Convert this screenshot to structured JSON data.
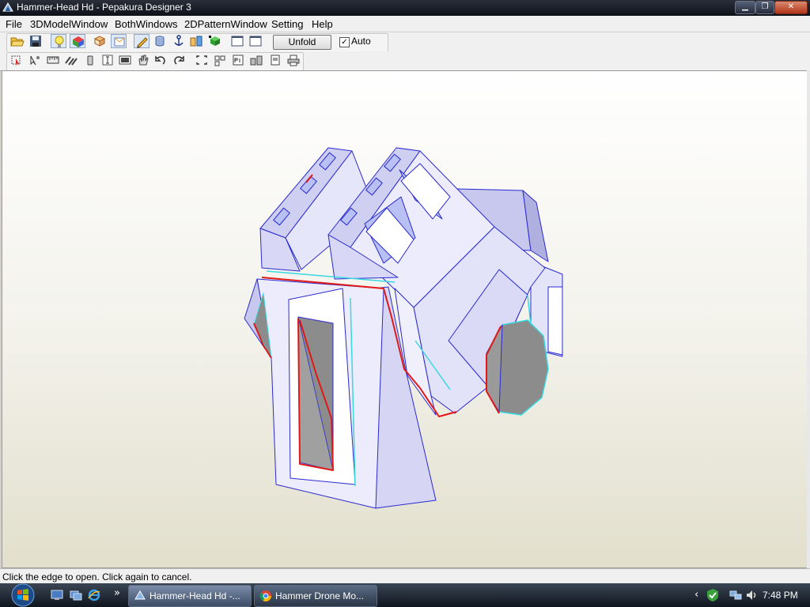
{
  "window": {
    "title": "Hammer-Head Hd - Pepakura Designer 3",
    "minimize_label": "▁",
    "restore_label": "❐",
    "close_label": "✕"
  },
  "menu": {
    "file": "File",
    "model3d": "3DModelWindow",
    "both": "BothWindows",
    "pattern2d": "2DPatternWindow",
    "setting": "Setting",
    "help": "Help"
  },
  "toolbar": {
    "unfold_label": "Unfold",
    "auto_checked": "✓",
    "auto_label": "Auto"
  },
  "status": {
    "text": "Click the edge to open. Click again to cancel."
  },
  "taskbar": {
    "chevron": "»",
    "task1": "Hammer-Head Hd -...",
    "task2": "Hammer Drone Mo...",
    "tray_chevron": "‹",
    "clock": "7:48 PM"
  },
  "colors": {
    "model_face": "#dcdcf6",
    "model_edge": "#2a2ad0",
    "cut_edge": "#e01818",
    "highlight_edge": "#39d8e0",
    "hole_fill": "#8c8c8c"
  }
}
